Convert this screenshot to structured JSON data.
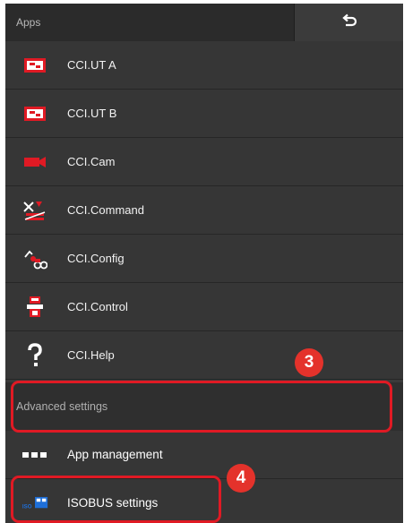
{
  "header": {
    "title": "Apps",
    "back_icon": "back-arrow-icon"
  },
  "apps": [
    {
      "label": "CCI.UT A",
      "icon": "terminal-icon"
    },
    {
      "label": "CCI.UT B",
      "icon": "terminal-icon"
    },
    {
      "label": "CCI.Cam",
      "icon": "camera-icon"
    },
    {
      "label": "CCI.Command",
      "icon": "command-icon"
    },
    {
      "label": "CCI.Config",
      "icon": "config-icon"
    },
    {
      "label": "CCI.Control",
      "icon": "control-icon"
    },
    {
      "label": "CCI.Help",
      "icon": "help-icon"
    }
  ],
  "advanced": {
    "title": "Advanced settings",
    "items": [
      {
        "label": "App management",
        "icon": "app-management-icon"
      },
      {
        "label": "ISOBUS settings",
        "icon": "isobus-icon",
        "icon_text": "ISO"
      }
    ]
  },
  "callouts": [
    "3",
    "4"
  ],
  "colors": {
    "panel_bg": "#3a3a3a",
    "header_bg": "#2b2b2b",
    "accent_red": "#e01a24",
    "isobus_blue": "#1e6fd9"
  }
}
